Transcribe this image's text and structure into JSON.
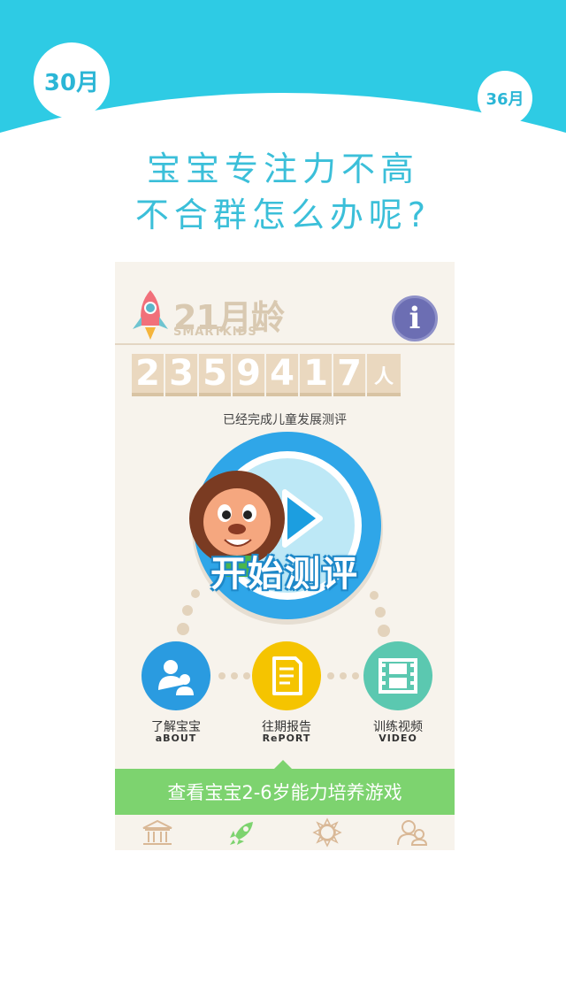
{
  "banner": {
    "background_color": "#2ecbe4",
    "left_pin_label": "30月",
    "right_pin_label": "36月"
  },
  "headline": {
    "line1": "宝宝专注力不高",
    "line2": "不合群怎么办呢?"
  },
  "app": {
    "logo": {
      "age_number": "21",
      "age_unit": "月龄",
      "brand": "SMARTKIDS"
    },
    "info_button_label": "i",
    "counter": {
      "digits": [
        "2",
        "3",
        "5",
        "9",
        "4",
        "1",
        "7"
      ],
      "unit": "人"
    },
    "counter_caption": "已经完成儿童发展测评",
    "start_button_label": "开始测评",
    "actions": [
      {
        "label": "了解宝宝",
        "sub": "aBOUT",
        "color": "#2a9be0",
        "icon": "parents-icon"
      },
      {
        "label": "往期报告",
        "sub": "RePORT",
        "color": "#f5c400",
        "icon": "report-icon"
      },
      {
        "label": "训练视频",
        "sub": "VIDEO",
        "color": "#5bc8b0",
        "icon": "film-icon"
      }
    ],
    "games_banner": "查看宝宝2-6岁能力培养游戏",
    "tabs": [
      {
        "icon": "home-icon"
      },
      {
        "icon": "rocket-icon"
      },
      {
        "icon": "sun-icon"
      },
      {
        "icon": "users-icon"
      }
    ]
  }
}
